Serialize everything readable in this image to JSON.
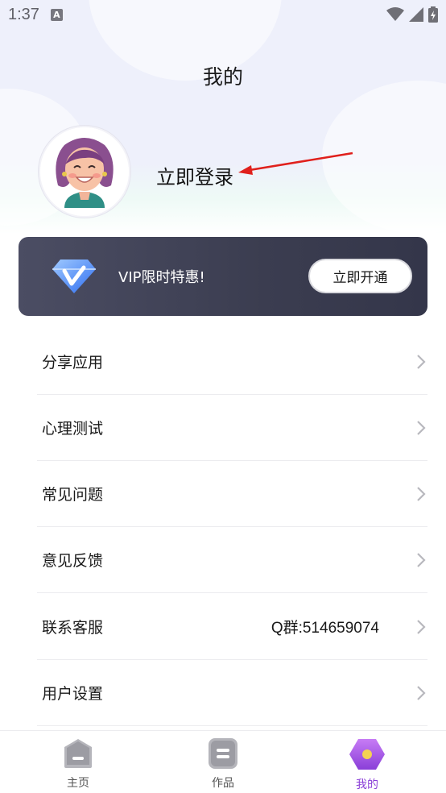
{
  "status_bar": {
    "time": "1:37",
    "notification_letter": "A"
  },
  "header": {
    "title": "我的"
  },
  "profile": {
    "login_text": "立即登录"
  },
  "vip": {
    "text": "VIP限时特惠!",
    "button": "立即开通"
  },
  "menu": {
    "items": [
      {
        "label": "分享应用",
        "value": ""
      },
      {
        "label": "心理测试",
        "value": ""
      },
      {
        "label": "常见问题",
        "value": ""
      },
      {
        "label": "意见反馈",
        "value": ""
      },
      {
        "label": "联系客服",
        "value": "Q群:514659074"
      },
      {
        "label": "用户设置",
        "value": ""
      }
    ]
  },
  "bottom_nav": {
    "home": "主页",
    "works": "作品",
    "mine": "我的"
  },
  "colors": {
    "accent": "#8b3fd8",
    "vip_card": "#3e4054",
    "annotation_arrow": "#e0201c"
  },
  "icons": [
    "wifi-icon",
    "signal-icon",
    "battery-icon",
    "vip-diamond-icon",
    "chevron-right-icon",
    "home-icon",
    "works-icon",
    "mine-icon"
  ]
}
